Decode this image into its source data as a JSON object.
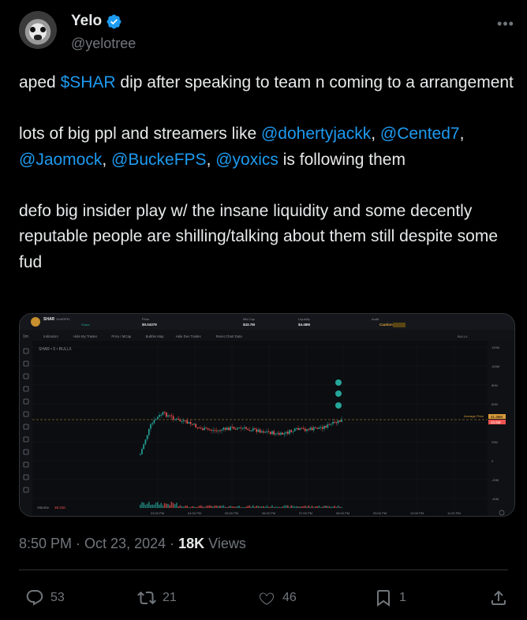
{
  "author": {
    "name": "Yelo",
    "handle": "@yelotree"
  },
  "more_label": "•••",
  "tweet": {
    "para1": {
      "pre": "aped ",
      "cashtag": "$SHAR",
      "post": " dip after speaking to team n coming to a arrangement"
    },
    "para2": {
      "pre": "lots of big ppl and streamers like ",
      "m1": "@dohertyjackk",
      "s1": ", ",
      "m2": "@Cented7",
      "s2": ", ",
      "m3": "@Jaomock",
      "s3": ", ",
      "m4": "@BuckeFPS",
      "s4": ", ",
      "m5": "@yoxics",
      "post": " is following them"
    },
    "para3": "defo big insider play w/ the insane liquidity and some decently reputable people are shilling/talking about them still despite some fud"
  },
  "chart_card": {
    "token": {
      "symbol": "SHAR",
      "name": "SHARPEI",
      "share": "Share"
    },
    "stats": [
      {
        "label": "Price",
        "value": "$0.04379"
      },
      {
        "label": "Mkt Cap",
        "value": "$43.7M"
      },
      {
        "label": "Liquidity",
        "value": "$4.48M"
      },
      {
        "label": "Audit",
        "value": "Caution"
      }
    ],
    "toolbar": [
      "Indicators",
      "Hide My Trades",
      "Price / MCap",
      "Bubble Map",
      "Hide Dev Trades",
      "Reset Chart Data"
    ],
    "interval": "1m",
    "exchange_label": "BULLX",
    "series_label": "SHAR • 5 • BULLX",
    "volume_label": "Volume",
    "volume_value": "39.31K",
    "avg_price_label": "Average Price",
    "avg_price_value": "41.36M",
    "current_value": "43.6M",
    "y_ticks": [
      "120M",
      "100M",
      "80M",
      "60M",
      "40M",
      "20M",
      "0",
      "-20M",
      "-40M"
    ],
    "x_ticks": [
      "03:00 PM",
      "04:00 PM",
      "05:00 PM",
      "06:00 PM",
      "07:00 PM",
      "08:00 PM",
      "09:00 PM",
      "10:00 PM",
      "11:00 PM"
    ]
  },
  "meta": {
    "time": "8:50 PM",
    "sep": " · ",
    "date": "Oct 23, 2024",
    "dot": " · ",
    "views": "18K",
    "views_label": " Views"
  },
  "actions": {
    "replies": "53",
    "reposts": "21",
    "likes": "46",
    "bookmarks": "1"
  },
  "colors": {
    "accent": "#1d9bf0",
    "muted": "#71767b",
    "candle_up": "#26a69a",
    "candle_down": "#ef5350"
  }
}
